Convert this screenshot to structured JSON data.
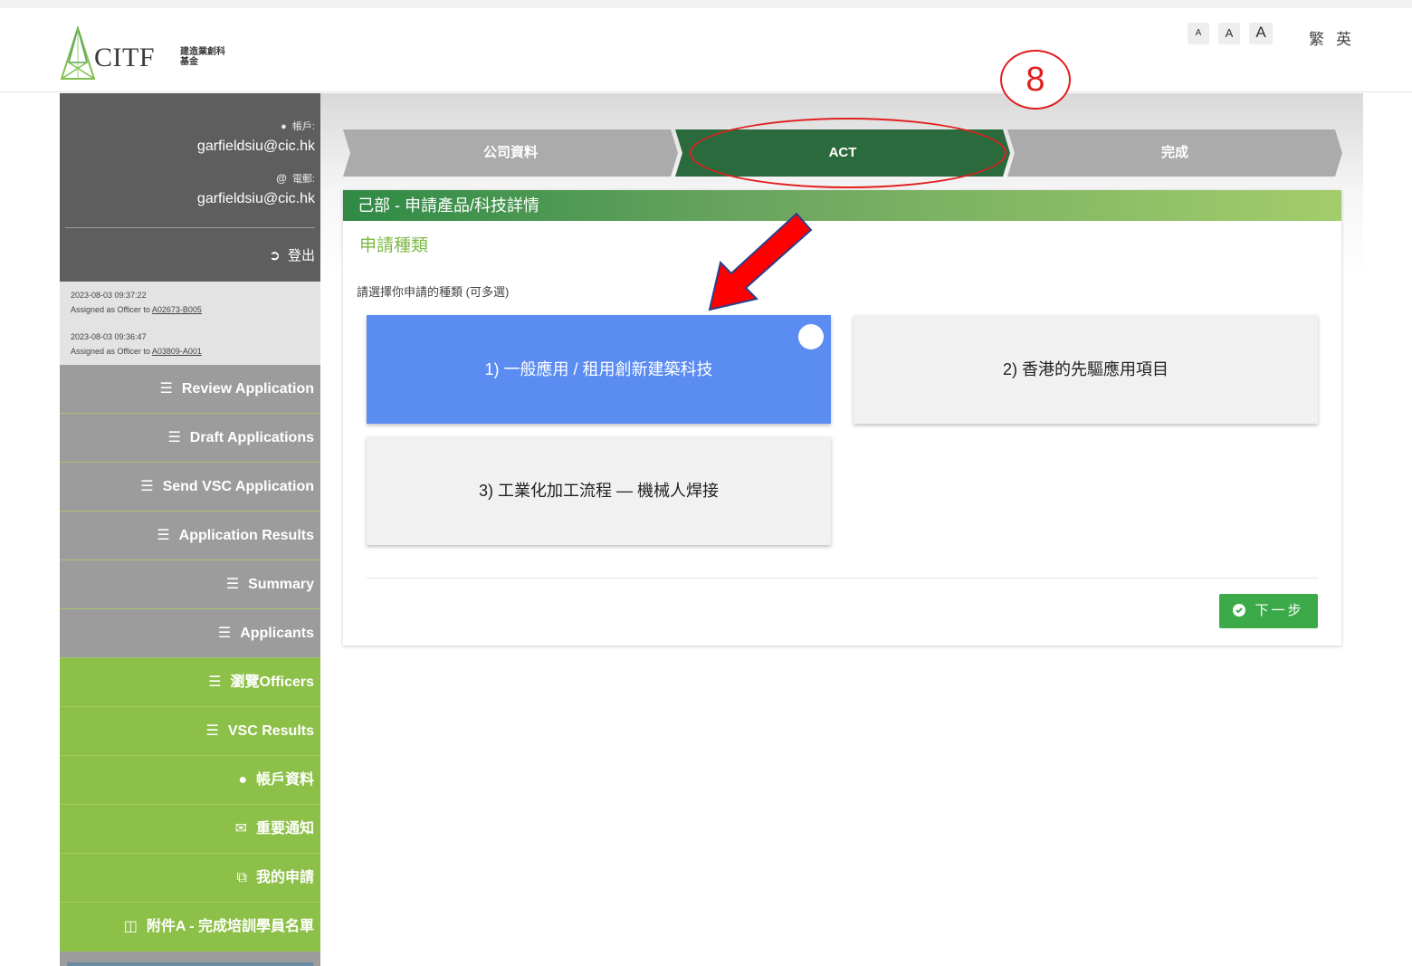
{
  "header": {
    "logo_text": "CITF",
    "logo_sub": "建造業創科基金",
    "font_sizes": [
      "A",
      "A",
      "A"
    ],
    "languages": [
      "繁",
      "英"
    ]
  },
  "annotation": {
    "step_number": "8"
  },
  "sidebar": {
    "account_label": "帳戶:",
    "account_value": "garfieldsiu@cic.hk",
    "email_label": "電郵:",
    "email_value": "garfieldsiu@cic.hk",
    "logout_label": "登出",
    "notifications": [
      {
        "date": "2023-08-03 09:37:22",
        "text": "Assigned as Officer to ",
        "link": "A02673-B005"
      },
      {
        "date": "2023-08-03 09:36:47",
        "text": "Assigned as Officer to ",
        "link": "A03809-A001"
      }
    ],
    "items": [
      {
        "label": "Review Application",
        "icon": "list-icon"
      },
      {
        "label": "Draft Applications",
        "icon": "list-icon"
      },
      {
        "label": "Send VSC Application",
        "icon": "list-icon"
      },
      {
        "label": "Application Results",
        "icon": "list-icon"
      },
      {
        "label": "Summary",
        "icon": "list-icon"
      },
      {
        "label": "Applicants",
        "icon": "list-icon"
      },
      {
        "label": "瀏覽Officers",
        "icon": "list-icon"
      },
      {
        "label": "VSC Results",
        "icon": "list-icon"
      },
      {
        "label": "帳戶資料",
        "icon": "user-icon"
      },
      {
        "label": "重要通知",
        "icon": "envelope-icon"
      },
      {
        "label": "我的申請",
        "icon": "share-icon"
      },
      {
        "label": "附件A - 完成培訓學員名單",
        "icon": "pdf-icon"
      }
    ]
  },
  "steps": [
    "公司資料",
    "ACT",
    "完成"
  ],
  "panel": {
    "title": "己部 - 申請產品/科技詳情",
    "section_title": "申請種類",
    "instruction": "請選擇你申請的種類 (可多選)",
    "options": [
      {
        "label": "1) 一般應用 / 租用創新建築科技",
        "selected": true
      },
      {
        "label": "2) 香港的先驅應用項目",
        "selected": false
      },
      {
        "label": "3) 工業化加工流程 — 機械人焊接",
        "selected": false
      }
    ],
    "next_label": "下一步"
  },
  "colors": {
    "accent_green": "#8dc048",
    "step_active": "#2b6a3c",
    "selected_option": "#5b8cf2",
    "annotation_red": "#e02020"
  }
}
